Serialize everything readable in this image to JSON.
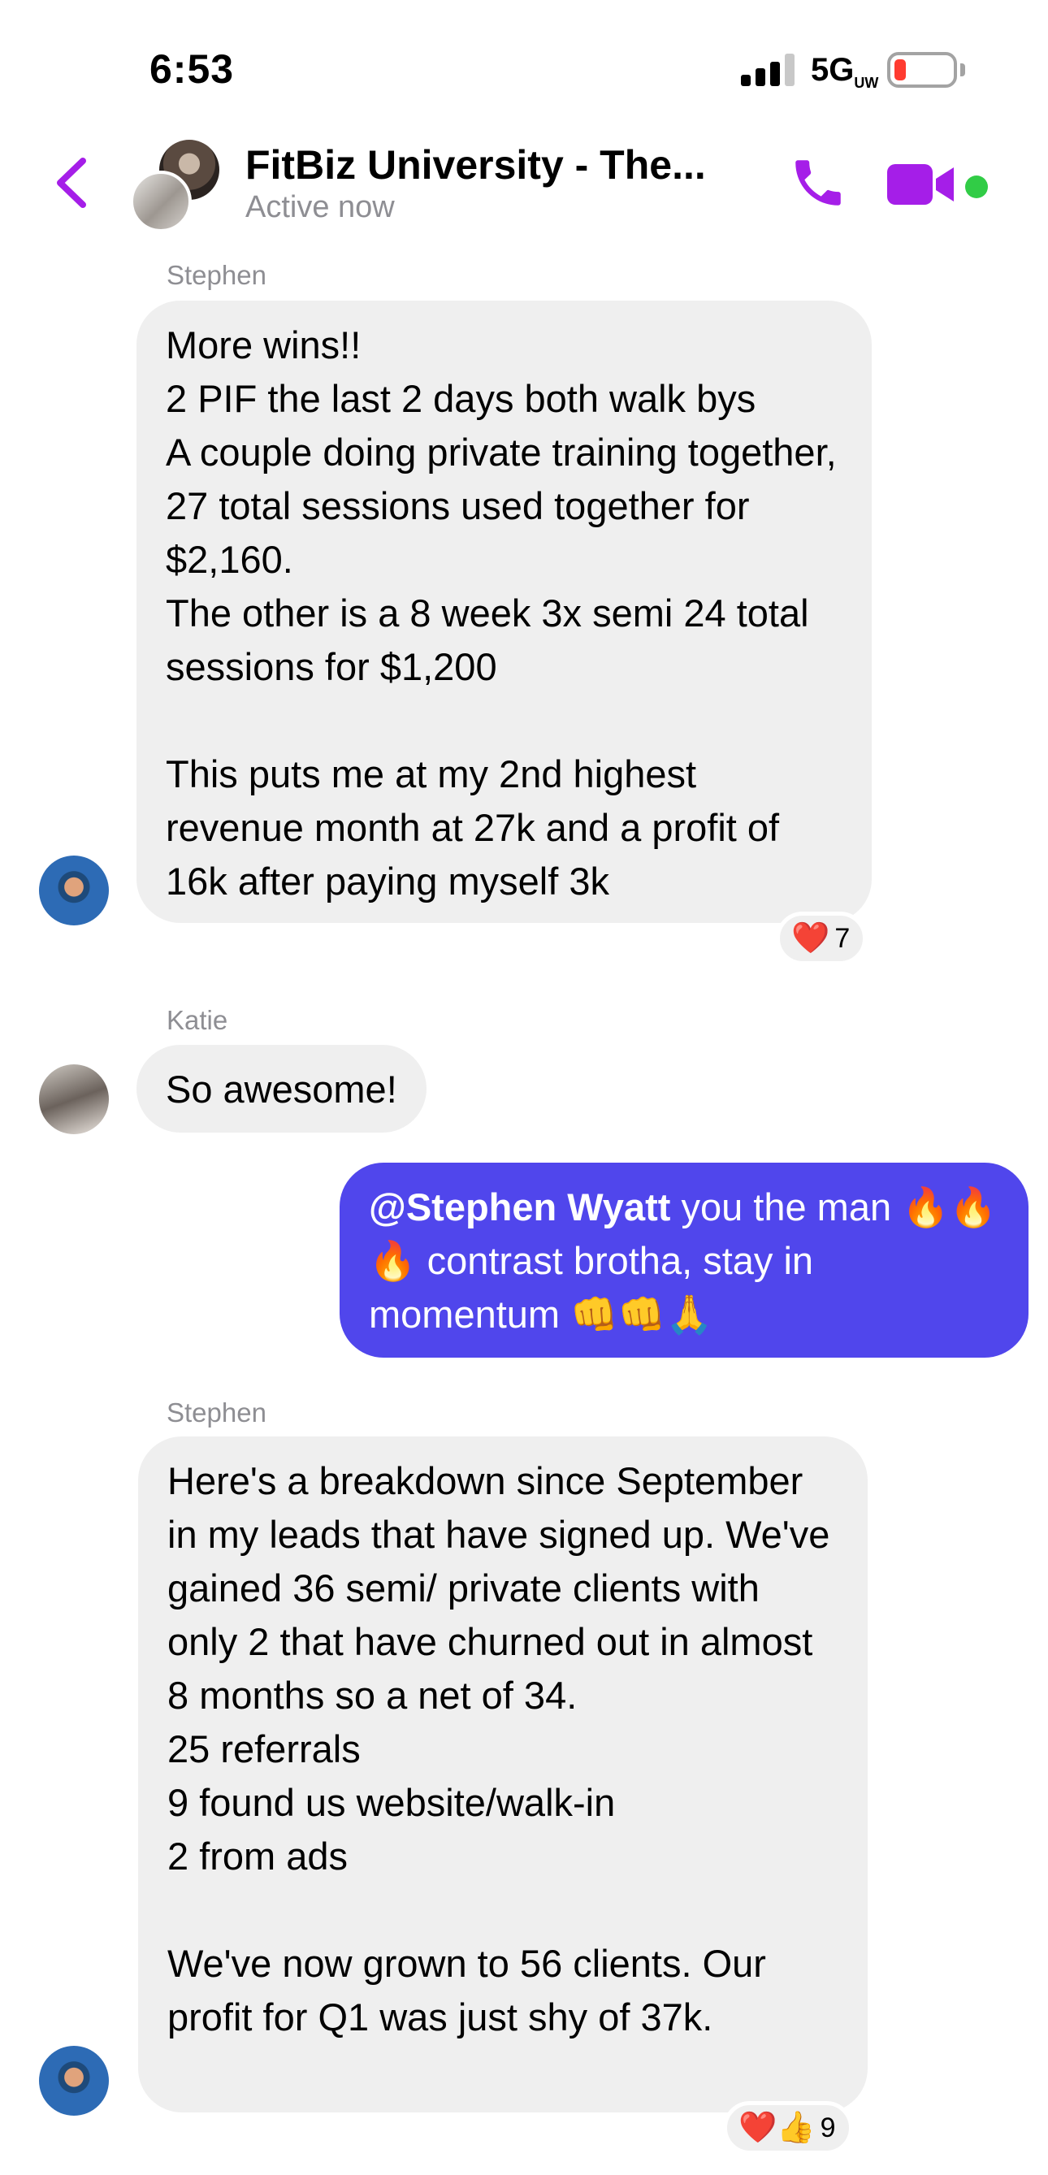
{
  "status_bar": {
    "time": "6:53",
    "network": "5G",
    "network_suffix": "UW",
    "battery_color": "#ff3b30"
  },
  "header": {
    "back_icon": "chevron-left-icon",
    "title": "FitBiz University - The...",
    "subtitle": "Active now",
    "call_icon": "phone-icon",
    "video_icon": "video-camera-icon",
    "accent_color": "#a51ee8",
    "online_color": "#31cc46"
  },
  "messages": [
    {
      "sender": "Stephen",
      "text": "More wins!!\n2 PIF the last 2 days both walk bys\nA couple doing private training together, 27 total sessions used together for $2,160.\nThe other is a 8 week 3x semi 24 total sessions for $1,200\n\nThis puts me at my 2nd highest revenue month at 27k and a profit of 16k after paying myself 3k",
      "reaction": {
        "emoji": "❤️",
        "count": "7"
      }
    },
    {
      "sender": "Katie",
      "text": "So awesome!"
    },
    {
      "mention": "@Stephen Wyatt",
      "text": " you the man 🔥🔥🔥 contrast brotha, stay in momentum 👊👊🙏"
    },
    {
      "sender": "Stephen",
      "text": "Here's a breakdown since September in my leads that have signed up.  We've gained 36 semi/ private clients with only 2 that have churned out in almost 8 months so a net of 34.\n25 referrals\n9 found us website/walk-in\n2 from ads\n\nWe've now grown to 56 clients. Our profit for Q1 was just shy of 37k.",
      "reaction": {
        "emoji": "❤️👍",
        "count": "9"
      }
    }
  ],
  "colors": {
    "incoming_bubble": "#efefef",
    "outgoing_bubble": "#5046ec"
  }
}
